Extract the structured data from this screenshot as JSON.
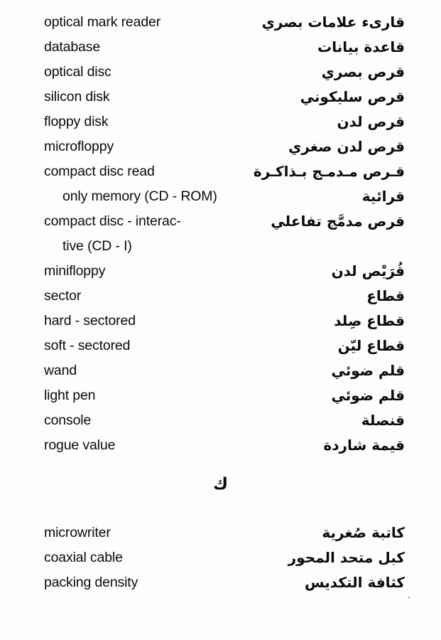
{
  "page": {
    "language_left": "English",
    "language_right": "Arabic",
    "section_divider_letter": "ك"
  },
  "entries": [
    {
      "english_lines": [
        "optical mark reader"
      ],
      "arabic_lines": [
        "قارىء علامات بصري"
      ]
    },
    {
      "english_lines": [
        "database"
      ],
      "arabic_lines": [
        "قاعدة بيانات"
      ]
    },
    {
      "english_lines": [
        "optical disc"
      ],
      "arabic_lines": [
        "قرص بصري"
      ]
    },
    {
      "english_lines": [
        "silicon disk"
      ],
      "arabic_lines": [
        "قرص سليكوني"
      ]
    },
    {
      "english_lines": [
        "floppy disk"
      ],
      "arabic_lines": [
        "قرص لدن"
      ]
    },
    {
      "english_lines": [
        "microfloppy"
      ],
      "arabic_lines": [
        "قرص لدن صغري"
      ]
    },
    {
      "english_lines": [
        "compact disc read",
        "only memory (CD - ROM)"
      ],
      "arabic_lines": [
        "قـرص مـدمـج بـذاكـرة",
        "قرائية"
      ]
    },
    {
      "english_lines": [
        "compact disc - interac-",
        "tive (CD - I)"
      ],
      "arabic_lines": [
        "قرص مدمَّج تفاعلي",
        ""
      ]
    },
    {
      "english_lines": [
        "minifloppy"
      ],
      "arabic_lines": [
        "قُرَيْص لدن"
      ]
    },
    {
      "english_lines": [
        "sector"
      ],
      "arabic_lines": [
        "قطاع"
      ]
    },
    {
      "english_lines": [
        "hard - sectored"
      ],
      "arabic_lines": [
        "قطاع صِلد"
      ]
    },
    {
      "english_lines": [
        "soft - sectored"
      ],
      "arabic_lines": [
        "قطاع ليّن"
      ]
    },
    {
      "english_lines": [
        "wand"
      ],
      "arabic_lines": [
        "قلم ضوئي"
      ]
    },
    {
      "english_lines": [
        "light pen"
      ],
      "arabic_lines": [
        "قلم ضوئي"
      ]
    },
    {
      "english_lines": [
        "console"
      ],
      "arabic_lines": [
        "قنصلة"
      ]
    },
    {
      "english_lines": [
        "rogue value"
      ],
      "arabic_lines": [
        "قيمة شاردة"
      ]
    }
  ],
  "entries_after_divider": [
    {
      "english_lines": [
        "microwriter"
      ],
      "arabic_lines": [
        "كاتبة صُغرية"
      ]
    },
    {
      "english_lines": [
        "coaxial cable"
      ],
      "arabic_lines": [
        "كبل متحد المحور"
      ]
    },
    {
      "english_lines": [
        "packing density"
      ],
      "arabic_lines": [
        "كثافة التكديس"
      ]
    }
  ]
}
